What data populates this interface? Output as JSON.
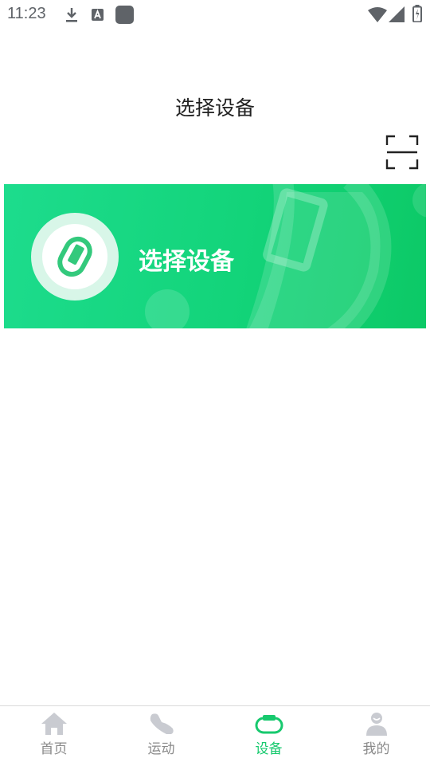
{
  "status_bar": {
    "time": "11:23",
    "icons": [
      "download-icon",
      "text-a-icon",
      "app-square-icon",
      "wifi-icon",
      "signal-icon",
      "battery-icon"
    ]
  },
  "header": {
    "title": "选择设备",
    "scan_icon": "scan-icon"
  },
  "banner": {
    "label": "选择设备",
    "icon": "band-icon",
    "colors": {
      "start": "#1ddc8d",
      "end": "#0cc966"
    }
  },
  "tabbar": {
    "active_color": "#17c96e",
    "inactive_color": "#8a8a8a",
    "tabs": [
      {
        "label": "首页",
        "icon": "home-icon",
        "active": false
      },
      {
        "label": "运动",
        "icon": "shoe-icon",
        "active": false
      },
      {
        "label": "设备",
        "icon": "band-icon",
        "active": true
      },
      {
        "label": "我的",
        "icon": "person-icon",
        "active": false
      }
    ]
  }
}
